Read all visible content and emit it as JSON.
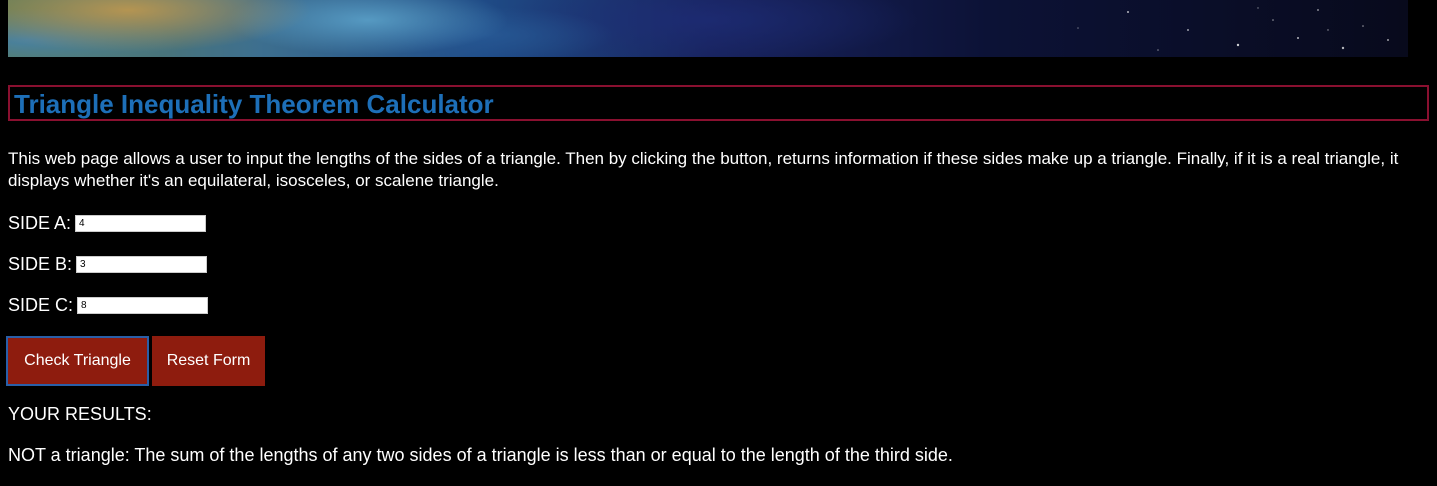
{
  "page": {
    "title": "Triangle Inequality Theorem Calculator",
    "description": "This web page allows a user to input the lengths of the sides of a triangle. Then by clicking the button, returns information if these sides make up a triangle. Finally, if it is a real triangle, it displays whether it's an equilateral, isosceles, or scalene triangle."
  },
  "form": {
    "side_a": {
      "label": "SIDE A:",
      "value": "4"
    },
    "side_b": {
      "label": "SIDE B:",
      "value": "3"
    },
    "side_c": {
      "label": "SIDE C:",
      "value": "8"
    },
    "check_label": "Check Triangle",
    "reset_label": "Reset Form"
  },
  "results": {
    "heading": "YOUR RESULTS:",
    "message": "NOT a triangle: The sum of the lengths of any two sides of a triangle is less than or equal to the length of the third side."
  },
  "colors": {
    "title": "#1d6fb8",
    "title_border": "#8a1030",
    "button": "#8e1c0e",
    "focus_outline": "#2a5fa8",
    "background": "#000000"
  }
}
